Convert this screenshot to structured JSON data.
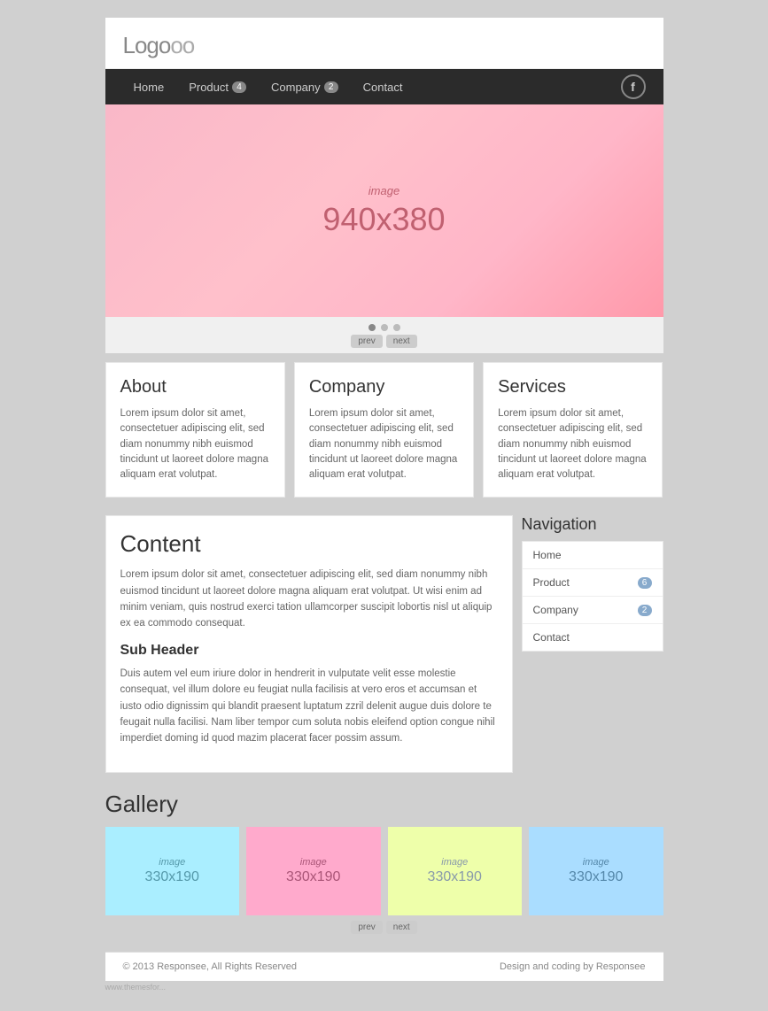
{
  "logo": {
    "bold": "Logo",
    "light": "oo"
  },
  "nav": {
    "items": [
      {
        "label": "Home",
        "badge": null
      },
      {
        "label": "Product",
        "badge": "4"
      },
      {
        "label": "Company",
        "badge": "2"
      },
      {
        "label": "Contact",
        "badge": null
      }
    ],
    "facebook_label": "f"
  },
  "hero": {
    "label": "image",
    "size": "940x380"
  },
  "slider": {
    "prev": "prev",
    "next": "next"
  },
  "cards": [
    {
      "title": "About",
      "text": "Lorem ipsum dolor sit amet, consectetuer adipiscing elit, sed diam nonummy nibh euismod tincidunt ut laoreet dolore magna aliquam erat volutpat."
    },
    {
      "title": "Company",
      "text": "Lorem ipsum dolor sit amet, consectetuer adipiscing elit, sed diam nonummy nibh euismod tincidunt ut laoreet dolore magna aliquam erat volutpat."
    },
    {
      "title": "Services",
      "text": "Lorem ipsum dolor sit amet, consectetuer adipiscing elit, sed diam nonummy nibh euismod tincidunt ut laoreet dolore magna aliquam erat volutpat."
    }
  ],
  "content": {
    "title": "Content",
    "text1": "Lorem ipsum dolor sit amet, consectetuer adipiscing elit, sed diam nonummy nibh euismod tincidunt ut laoreet dolore magna aliquam erat volutpat. Ut wisi enim ad minim veniam, quis nostrud exerci tation ullamcorper suscipit lobortis nisl ut aliquip ex ea commodo consequat.",
    "sub_header": "Sub Header",
    "text2": "Duis autem vel eum iriure dolor in hendrerit in vulputate velit esse molestie consequat, vel illum dolore eu feugiat nulla facilisis at vero eros et accumsan et iusto odio dignissim qui blandit praesent luptatum zzril delenit augue duis dolore te feugait nulla facilisi. Nam liber tempor cum soluta nobis eleifend option congue nihil imperdiet doming id quod mazim placerat facer possim assum."
  },
  "sidebar_nav": {
    "title": "Navigation",
    "items": [
      {
        "label": "Home",
        "badge": null
      },
      {
        "label": "Product",
        "badge": "6"
      },
      {
        "label": "Company",
        "badge": "2"
      },
      {
        "label": "Contact",
        "badge": null
      }
    ]
  },
  "gallery": {
    "title": "Gallery",
    "items": [
      {
        "label": "image",
        "size": "330x190",
        "color": "cyan"
      },
      {
        "label": "image",
        "size": "330x190",
        "color": "pink"
      },
      {
        "label": "image",
        "size": "330x190",
        "color": "yellow"
      },
      {
        "label": "image",
        "size": "330x190",
        "color": "cyan2"
      }
    ],
    "prev": "prev",
    "next": "next"
  },
  "footer": {
    "copyright": "© 2013 Responsee, All Rights Reserved",
    "credit": "Design and coding by Responsee"
  },
  "watermark": "www.themesfor..."
}
